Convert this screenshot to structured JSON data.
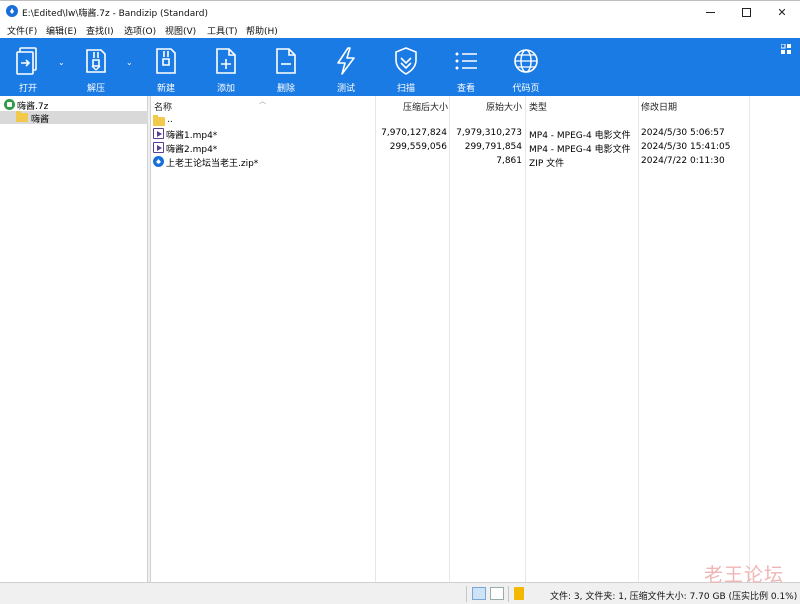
{
  "window": {
    "title": "E:\\Edited\\lw\\嗨酱.7z - Bandizip (Standard)"
  },
  "menu": [
    "文件(F)",
    "编辑(E)",
    "查找(I)",
    "选项(O)",
    "视图(V)",
    "工具(T)",
    "帮助(H)"
  ],
  "toolbar": {
    "open": "打开",
    "extract": "解压",
    "new": "新建",
    "add": "添加",
    "delete": "删除",
    "test": "测试",
    "scan": "扫描",
    "view": "查看",
    "codepage": "代码页"
  },
  "tree": {
    "archive": "嗨酱.7z",
    "folder": "嗨酱"
  },
  "columns": {
    "name": "名称",
    "compressed": "压缩后大小",
    "original": "原始大小",
    "type": "类型",
    "modified": "修改日期"
  },
  "files": [
    {
      "name": "..",
      "compressed": "",
      "original": "",
      "type": "",
      "modified": ""
    },
    {
      "name": "嗨酱1.mp4*",
      "compressed": "7,970,127,824",
      "original": "7,979,310,273",
      "type": "MP4 - MPEG-4 电影文件",
      "modified": "2024/5/30 5:06:57"
    },
    {
      "name": "嗨酱2.mp4*",
      "compressed": "299,559,056",
      "original": "299,791,854",
      "type": "MP4 - MPEG-4 电影文件",
      "modified": "2024/5/30 15:41:05"
    },
    {
      "name": "上老王论坛当老王.zip*",
      "compressed": "",
      "original": "7,861",
      "type": "ZIP 文件",
      "modified": "2024/7/22 0:11:30"
    }
  ],
  "status": {
    "text": "文件: 3, 文件夹: 1, 压缩文件大小: 7.70 GB (压实比例 0.1%)"
  },
  "watermark": "老王论坛",
  "colors": {
    "toolbar": "#1b7be4",
    "selection": "#d9d9d9"
  }
}
